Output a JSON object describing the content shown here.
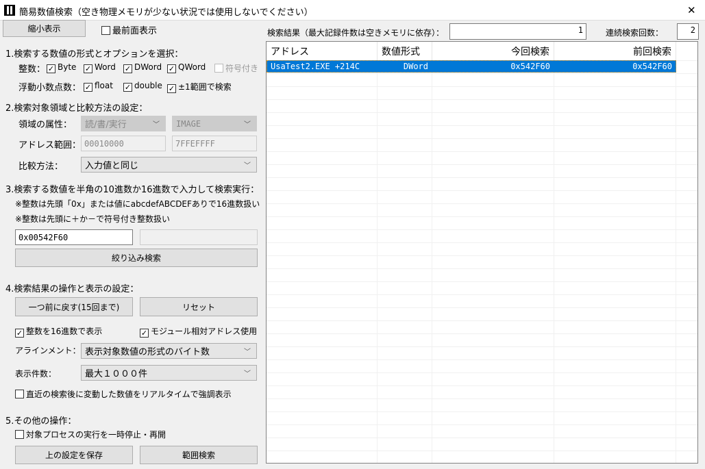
{
  "window": {
    "title": "簡易数値検索（空き物理メモリが少ない状況では使用しないでください）",
    "close": "✕"
  },
  "top": {
    "shrink_button": "縮小表示",
    "topmost_label": "最前面表示",
    "topmost_checked": false
  },
  "section1": {
    "title": "1.検索する数値の形式とオプションを選択：",
    "int_label": "整数：",
    "int_options": [
      {
        "label": "Byte",
        "checked": true
      },
      {
        "label": "Word",
        "checked": true
      },
      {
        "label": "DWord",
        "checked": true
      },
      {
        "label": "QWord",
        "checked": true
      },
      {
        "label": "符号付き",
        "checked": false,
        "disabled": true
      }
    ],
    "float_label": "浮動小数点数：",
    "float_options": [
      {
        "label": "float",
        "checked": true
      },
      {
        "label": "double",
        "checked": true
      },
      {
        "label": "±1範囲で検索",
        "checked": true
      }
    ]
  },
  "section2": {
    "title": "2.検索対象領域と比較方法の設定：",
    "region_label": "領域の属性：",
    "region_value": "読/書/実行",
    "region_type": "IMAGE",
    "range_label": "アドレス範囲：",
    "range_start": "00010000",
    "range_end": "7FFEFFFF",
    "compare_label": "比較方法：",
    "compare_value": "入力値と同じ"
  },
  "section3": {
    "title": "3.検索する数値を半角の10進数か16進数で入力して検索実行：",
    "note1": "※整数は先頭「0x」または値にabcdefABCDEFありで16進数扱い",
    "note2": "※整数は先頭に＋か－で符号付き整数扱い",
    "value": "0x00542F60",
    "value2": "",
    "narrow_button": "絞り込み検索"
  },
  "section4": {
    "title": "4.検索結果の操作と表示の設定：",
    "undo_button": "一つ前に戻す(15回まで)",
    "reset_button": "リセット",
    "hex_label": "整数を16進数で表示",
    "hex_checked": true,
    "relative_label": "モジュール相対アドレス使用",
    "relative_checked": true,
    "align_label": "アラインメント：",
    "align_value": "表示対象数値の形式のバイト数",
    "count_label": "表示件数：",
    "count_value": "最大１０００件",
    "highlight_label": "直近の検索後に変動した数値をリアルタイムで強調表示",
    "highlight_checked": false
  },
  "section5": {
    "title": "5.その他の操作：",
    "pause_label": "対象プロセスの実行を一時停止・再開",
    "pause_checked": false,
    "save_button": "上の設定を保存",
    "range_button": "範囲検索"
  },
  "results": {
    "label": "検索結果（最大記録件数は空きメモリに依存）：",
    "count": "1",
    "repeat_label": "連続検索回数：",
    "repeat_count": "2",
    "columns": [
      "アドレス",
      "数値形式",
      "今回検索",
      "前回検索"
    ],
    "rows": [
      {
        "address": "UsaTest2.EXE +214C",
        "type": "DWord",
        "current": "0x542F60",
        "previous": "0x542F60",
        "selected": true
      }
    ]
  },
  "colors": {
    "selection": "#0078d7"
  }
}
